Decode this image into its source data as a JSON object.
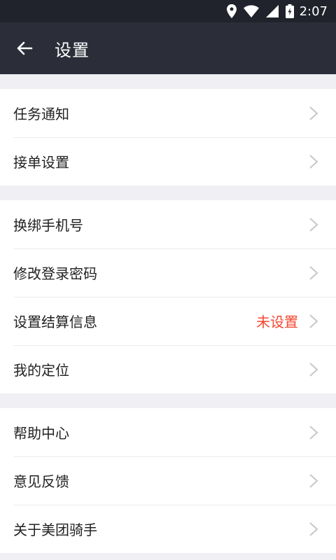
{
  "status_bar": {
    "time": "2:07",
    "icons": [
      "location-icon",
      "wifi-icon",
      "cell-signal-icon",
      "battery-charging-icon"
    ]
  },
  "toolbar": {
    "back_icon": "arrow-left-icon",
    "title": "设置"
  },
  "groups": [
    {
      "items": [
        {
          "label": "任务通知"
        },
        {
          "label": "接单设置"
        }
      ]
    },
    {
      "items": [
        {
          "label": "换绑手机号"
        },
        {
          "label": "修改登录密码"
        },
        {
          "label": "设置结算信息",
          "value": "未设置"
        },
        {
          "label": "我的定位"
        }
      ]
    },
    {
      "items": [
        {
          "label": "帮助中心"
        },
        {
          "label": "意见反馈"
        },
        {
          "label": "关于美团骑手"
        }
      ]
    }
  ],
  "colors": {
    "status_bar_bg": "#20232b",
    "toolbar_bg": "#2b2e38",
    "page_bg": "#efeff4",
    "value_red": "#f5472f",
    "chevron": "#c7c7cc"
  }
}
